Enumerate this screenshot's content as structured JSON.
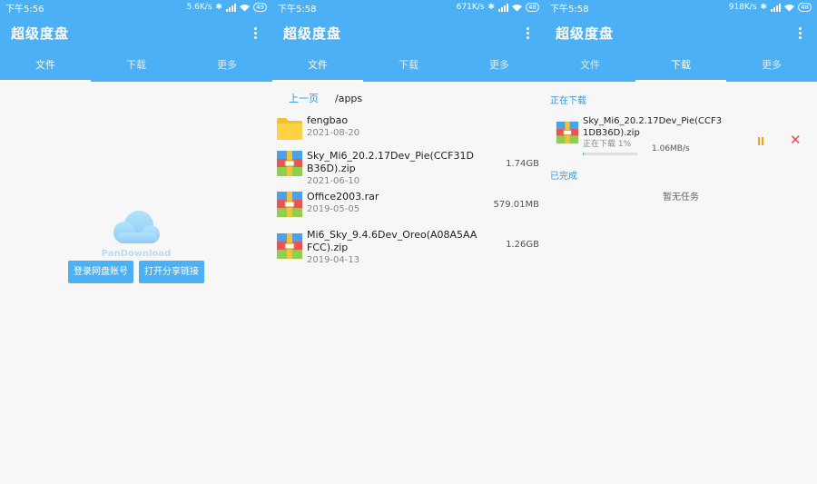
{
  "app": {
    "title": "超级度盘",
    "tabs": [
      "文件",
      "下载",
      "更多"
    ],
    "colors": {
      "primary": "#4bb0f5",
      "link": "#2e9be8",
      "pause": "#f5a020",
      "cancel": "#e94b4b"
    }
  },
  "screens": [
    {
      "status": {
        "time": "下午5:56",
        "speed": "5.6K/s",
        "battery": "49"
      },
      "active_tab": "文件",
      "brand": "PanDownload",
      "buttons": {
        "login": "登录网盘账号",
        "open_share": "打开分享链接"
      }
    },
    {
      "status": {
        "time": "下午5:58",
        "speed": "671K/s",
        "battery": "48"
      },
      "active_tab": "文件",
      "nav": {
        "back": "上一页",
        "path": "/apps"
      },
      "files": [
        {
          "name": "fengbao",
          "date": "2021-08-20",
          "size": "",
          "icon": "folder-icon"
        },
        {
          "name": "Sky_Mi6_20.2.17Dev_Pie(CCF31DB36D).zip",
          "date": "2021-06-10",
          "size": "1.74GB",
          "icon": "archive-icon"
        },
        {
          "name": "Office2003.rar",
          "date": "2019-05-05",
          "size": "579.01MB",
          "icon": "archive-icon"
        },
        {
          "name": "Mi6_Sky_9.4.6Dev_Oreo(A08A5AAFCC).zip",
          "date": "2019-04-13",
          "size": "1.26GB",
          "icon": "archive-icon"
        }
      ]
    },
    {
      "status": {
        "time": "下午5:58",
        "speed": "918K/s",
        "battery": "48"
      },
      "active_tab": "下载",
      "downloading_label": "正在下载",
      "download": {
        "name": "Sky_Mi6_20.2.17Dev_Pie(CCF31DB36D).zip",
        "status": "正在下载 1%",
        "speed": "1.06MB/s",
        "progress": 0.01
      },
      "completed_label": "已完成",
      "empty_text": "暂无任务"
    }
  ]
}
